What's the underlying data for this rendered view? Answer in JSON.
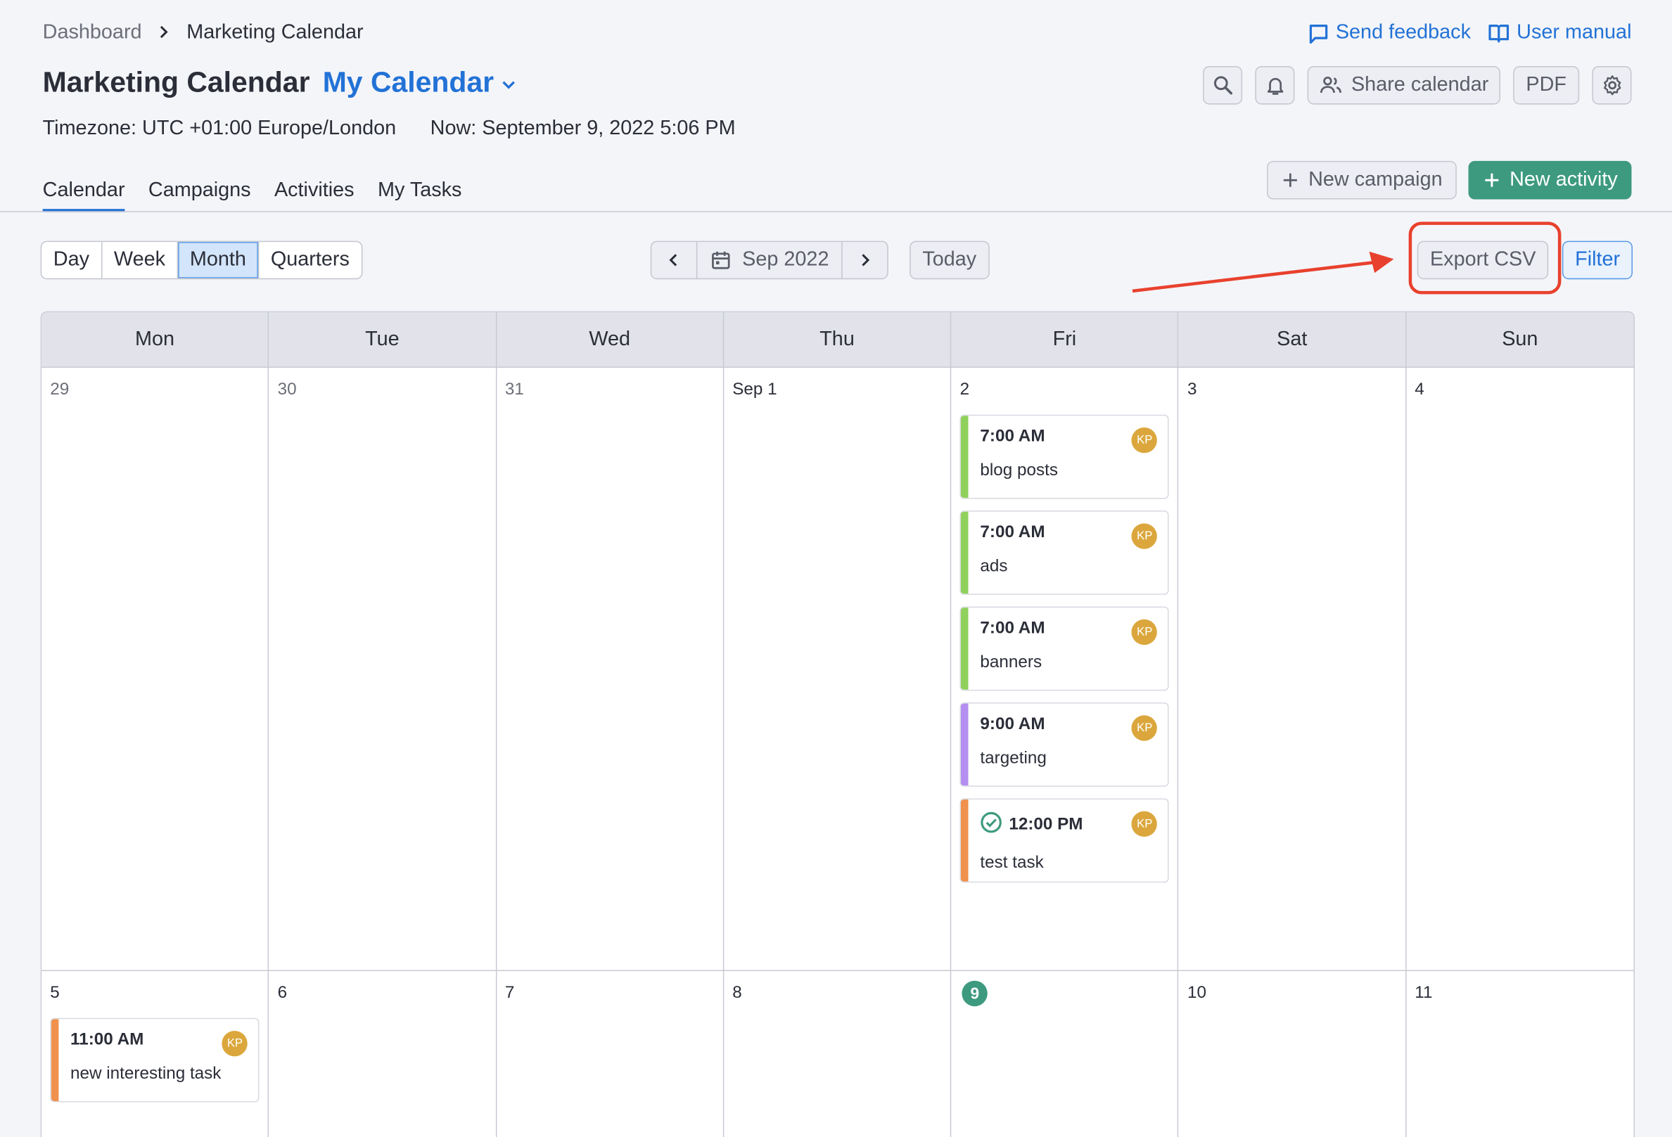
{
  "breadcrumb": {
    "parent": "Dashboard",
    "current": "Marketing Calendar"
  },
  "top_links": {
    "feedback": "Send feedback",
    "manual": "User manual"
  },
  "header": {
    "title": "Marketing Calendar",
    "calendar_name": "My Calendar"
  },
  "header_actions": {
    "share": "Share calendar",
    "pdf": "PDF"
  },
  "meta": {
    "timezone": "Timezone: UTC +01:00 Europe/London",
    "now": "Now: September 9, 2022 5:06 PM"
  },
  "tabs": [
    "Calendar",
    "Campaigns",
    "Activities",
    "My Tasks"
  ],
  "create": {
    "campaign": "New campaign",
    "activity": "New activity"
  },
  "views": [
    "Day",
    "Week",
    "Month",
    "Quarters"
  ],
  "active_view": "Month",
  "date_nav": {
    "label": "Sep 2022",
    "today": "Today"
  },
  "toolbar": {
    "export": "Export CSV",
    "filter": "Filter"
  },
  "weekdays": [
    "Mon",
    "Tue",
    "Wed",
    "Thu",
    "Fri",
    "Sat",
    "Sun"
  ],
  "colors": {
    "accent": "#2272d6",
    "primary": "#3d9a7e",
    "highlight": "#e8412d",
    "avatar": "#dba73c"
  },
  "weeks": [
    {
      "days": [
        {
          "label": "29",
          "muted": true,
          "events": []
        },
        {
          "label": "30",
          "muted": true,
          "events": []
        },
        {
          "label": "31",
          "muted": true,
          "events": []
        },
        {
          "label": "Sep 1",
          "events": []
        },
        {
          "label": "2",
          "events": [
            {
              "time": "7:00 AM",
              "title": "blog posts",
              "color": "#8fd15b",
              "avatar": "KP"
            },
            {
              "time": "7:00 AM",
              "title": "ads",
              "color": "#8fd15b",
              "avatar": "KP"
            },
            {
              "time": "7:00 AM",
              "title": "banners",
              "color": "#8fd15b",
              "avatar": "KP"
            },
            {
              "time": "9:00 AM",
              "title": "targeting",
              "color": "#b48ef0",
              "avatar": "KP"
            },
            {
              "time": "12:00 PM",
              "title": "test task",
              "color": "#f0914d",
              "avatar": "KP",
              "done": true
            }
          ]
        },
        {
          "label": "3",
          "events": []
        },
        {
          "label": "4",
          "events": []
        }
      ]
    },
    {
      "days": [
        {
          "label": "5",
          "events": [
            {
              "time": "11:00 AM",
              "title": "new interesting task",
              "color": "#f0914d",
              "avatar": "KP"
            }
          ]
        },
        {
          "label": "6",
          "events": []
        },
        {
          "label": "7",
          "events": []
        },
        {
          "label": "8",
          "events": []
        },
        {
          "label": "9",
          "today": true,
          "events": []
        },
        {
          "label": "10",
          "events": []
        },
        {
          "label": "11",
          "events": []
        }
      ]
    }
  ]
}
